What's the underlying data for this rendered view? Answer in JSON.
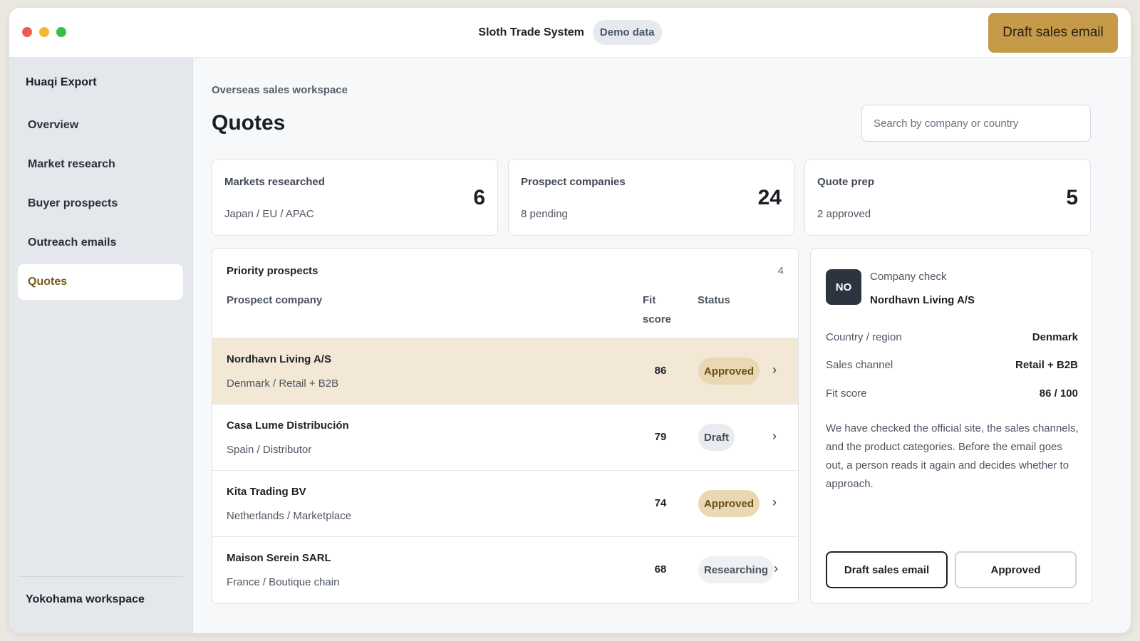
{
  "window": {
    "app_title": "Sloth Trade System",
    "badge": "Demo data",
    "cta_label": "Draft sales email"
  },
  "sidebar": {
    "org_name": "Huaqi Export",
    "items": [
      {
        "label": "Overview",
        "active": false
      },
      {
        "label": "Market research",
        "active": false
      },
      {
        "label": "Buyer prospects",
        "active": false
      },
      {
        "label": "Outreach emails",
        "active": false
      },
      {
        "label": "Quotes",
        "active": true
      }
    ],
    "workspace": "Yokohama workspace"
  },
  "main": {
    "breadcrumb": "Overseas sales workspace",
    "title": "Quotes",
    "search_placeholder": "Search by company or country"
  },
  "stats": [
    {
      "label": "Markets researched",
      "sub": "Japan / EU / APAC",
      "value": "6"
    },
    {
      "label": "Prospect companies",
      "sub": "8 pending",
      "value": "24"
    },
    {
      "label": "Quote prep",
      "sub": "2 approved",
      "value": "5"
    }
  ],
  "prospects": {
    "title": "Priority prospects",
    "count": "4",
    "headers": {
      "company": "Prospect company",
      "fit": "Fit score",
      "status": "Status"
    },
    "rows": [
      {
        "name": "Nordhavn Living A/S",
        "meta": "Denmark / Retail + B2B",
        "score": "86",
        "status": "Approved",
        "status_kind": "approved",
        "selected": true
      },
      {
        "name": "Casa Lume Distribución",
        "meta": "Spain / Distributor",
        "score": "79",
        "status": "Draft",
        "status_kind": "draft",
        "selected": false
      },
      {
        "name": "Kita Trading BV",
        "meta": "Netherlands / Marketplace",
        "score": "74",
        "status": "Approved",
        "status_kind": "approved",
        "selected": false
      },
      {
        "name": "Maison Serein SARL",
        "meta": "France / Boutique chain",
        "score": "68",
        "status": "Researching",
        "status_kind": "researching",
        "selected": false
      }
    ]
  },
  "detail": {
    "avatar": "NO",
    "label": "Company check",
    "company": "Nordhavn Living A/S",
    "fields": [
      {
        "key": "Country / region",
        "value": "Denmark"
      },
      {
        "key": "Sales channel",
        "value": "Retail + B2B"
      },
      {
        "key": "Fit score",
        "value": "86 / 100"
      }
    ],
    "note": "We have checked the official site, the sales channels, and the product categories. Before the email goes out, a person reads it again and decides whether to approach.",
    "draft_button": "Draft sales email",
    "approve_button": "Approved"
  },
  "colors": {
    "accent": "#c59a48",
    "selected_row": "#f3e8d5",
    "approved_badge": "#ead7b3",
    "avatar_bg": "#2c3440"
  }
}
